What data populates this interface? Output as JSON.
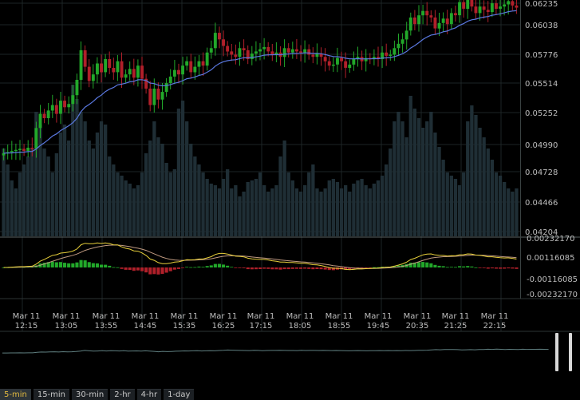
{
  "colors": {
    "background": "#000000",
    "grid": "#1d2526",
    "separator": "#4a5252",
    "up": "#22a82a",
    "down": "#b0202a",
    "volume": "#1f2e35",
    "ma": "#5a78e0",
    "macd_line": "#e8d03a",
    "macd_signal": "#c09a80",
    "hist_pos": "#22a82a",
    "hist_neg": "#b0202a",
    "overview_line": "#5f7f80"
  },
  "timeframes": [
    {
      "label": "5-min",
      "active": true
    },
    {
      "label": "15-min",
      "active": false
    },
    {
      "label": "30-min",
      "active": false
    },
    {
      "label": "2-hr",
      "active": false
    },
    {
      "label": "4-hr",
      "active": false
    },
    {
      "label": "1-day",
      "active": false
    }
  ],
  "chart_data": {
    "type": "candlestick",
    "grid": true,
    "price_axis": {
      "ticks": [
        "0.06235",
        "0.06038",
        "0.05776",
        "0.05514",
        "0.05252",
        "0.04990",
        "0.04728",
        "0.04466",
        "0.04204"
      ],
      "range": [
        0.041,
        0.0626
      ]
    },
    "time_axis": {
      "ticks": [
        {
          "date": "Mar 11",
          "time": "12:15"
        },
        {
          "date": "Mar 11",
          "time": "13:05"
        },
        {
          "date": "Mar 11",
          "time": "13:55"
        },
        {
          "date": "Mar 11",
          "time": "14:45"
        },
        {
          "date": "Mar 11",
          "time": "15:35"
        },
        {
          "date": "Mar 11",
          "time": "16:25"
        },
        {
          "date": "Mar 11",
          "time": "17:15"
        },
        {
          "date": "Mar 11",
          "time": "18:05"
        },
        {
          "date": "Mar 11",
          "time": "18:55"
        },
        {
          "date": "Mar 11",
          "time": "19:45"
        },
        {
          "date": "Mar 11",
          "time": "20:35"
        },
        {
          "date": "Mar 11",
          "time": "21:25"
        },
        {
          "date": "Mar 11",
          "time": "22:15"
        }
      ]
    },
    "close": [
      0.0486,
      0.0487,
      0.0488,
      0.0489,
      0.049,
      0.0488,
      0.0491,
      0.049,
      0.0509,
      0.0522,
      0.0518,
      0.0525,
      0.053,
      0.0522,
      0.0534,
      0.0528,
      0.0531,
      0.0539,
      0.0553,
      0.058,
      0.0565,
      0.0552,
      0.0558,
      0.0568,
      0.056,
      0.0572,
      0.0564,
      0.056,
      0.057,
      0.0555,
      0.0558,
      0.0563,
      0.0555,
      0.0566,
      0.0554,
      0.0545,
      0.053,
      0.0545,
      0.0535,
      0.0542,
      0.055,
      0.0556,
      0.0562,
      0.0558,
      0.0566,
      0.057,
      0.056,
      0.0565,
      0.057,
      0.0566,
      0.0578,
      0.0582,
      0.0596,
      0.059,
      0.0584,
      0.0579,
      0.0576,
      0.0574,
      0.0582,
      0.058,
      0.0572,
      0.0577,
      0.0579,
      0.0581,
      0.0583,
      0.0579,
      0.0576,
      0.0578,
      0.0574,
      0.0582,
      0.0578,
      0.0581,
      0.0579,
      0.0578,
      0.0581,
      0.0576,
      0.0574,
      0.0577,
      0.0574,
      0.057,
      0.0566,
      0.0567,
      0.0573,
      0.057,
      0.0564,
      0.0567,
      0.0572,
      0.0574,
      0.057,
      0.0573,
      0.0572,
      0.0574,
      0.0572,
      0.0578,
      0.0575,
      0.0576,
      0.0582,
      0.0586,
      0.059,
      0.0598,
      0.061,
      0.0604,
      0.0612,
      0.0616,
      0.0612,
      0.061,
      0.06,
      0.0605,
      0.0609,
      0.0604,
      0.0614,
      0.0612,
      0.0624,
      0.0618,
      0.0626,
      0.062,
      0.0614,
      0.062,
      0.0617,
      0.0615,
      0.0623,
      0.0618,
      0.062,
      0.0622,
      0.0625,
      0.0621,
      0.0619
    ],
    "volume": [
      0.55,
      0.45,
      0.35,
      0.3,
      0.4,
      0.45,
      0.5,
      0.55,
      0.78,
      0.7,
      0.55,
      0.5,
      0.4,
      0.52,
      0.65,
      0.7,
      0.6,
      0.95,
      0.86,
      0.78,
      0.72,
      0.6,
      0.55,
      0.65,
      0.72,
      0.7,
      0.5,
      0.45,
      0.4,
      0.38,
      0.35,
      0.33,
      0.3,
      0.32,
      0.4,
      0.52,
      0.6,
      0.72,
      0.62,
      0.58,
      0.46,
      0.4,
      0.42,
      0.8,
      0.85,
      0.72,
      0.58,
      0.5,
      0.45,
      0.4,
      0.36,
      0.33,
      0.32,
      0.3,
      0.36,
      0.42,
      0.3,
      0.32,
      0.25,
      0.28,
      0.34,
      0.35,
      0.36,
      0.4,
      0.32,
      0.28,
      0.3,
      0.32,
      0.5,
      0.6,
      0.4,
      0.35,
      0.3,
      0.28,
      0.32,
      0.4,
      0.45,
      0.3,
      0.28,
      0.3,
      0.35,
      0.36,
      0.34,
      0.3,
      0.32,
      0.28,
      0.33,
      0.35,
      0.36,
      0.32,
      0.3,
      0.33,
      0.35,
      0.38,
      0.45,
      0.55,
      0.72,
      0.78,
      0.72,
      0.62,
      0.88,
      0.8,
      0.74,
      0.68,
      0.72,
      0.78,
      0.65,
      0.56,
      0.48,
      0.4,
      0.38,
      0.36,
      0.32,
      0.4,
      0.72,
      0.82,
      0.76,
      0.68,
      0.62,
      0.55,
      0.48,
      0.4,
      0.38,
      0.34,
      0.3,
      0.28,
      0.3
    ],
    "macd": {
      "ticks": [
        "0.00232170",
        "0.00116085",
        "-0.00116085",
        "-0.00232170"
      ],
      "range": [
        -0.0023217,
        0.0023217
      ]
    }
  }
}
